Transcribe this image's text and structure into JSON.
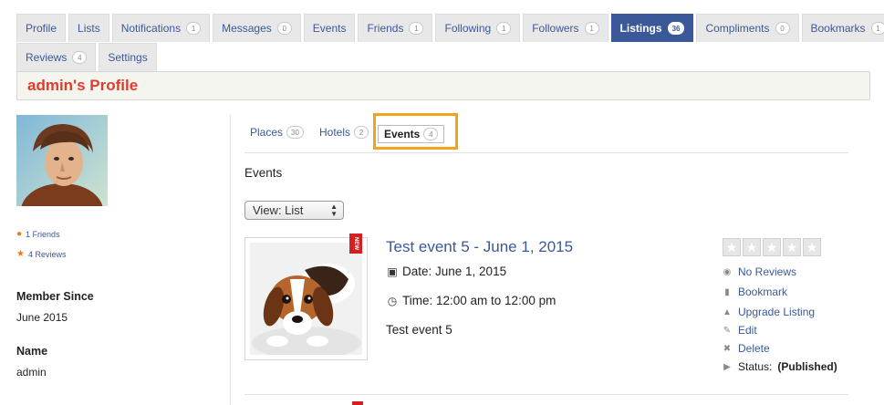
{
  "tabs_row1": [
    {
      "label": "Profile",
      "badge": null,
      "active": false
    },
    {
      "label": "Lists",
      "badge": null,
      "active": false
    },
    {
      "label": "Notifications",
      "badge": "1",
      "active": false
    },
    {
      "label": "Messages",
      "badge": "0",
      "active": false
    },
    {
      "label": "Events",
      "badge": null,
      "active": false
    },
    {
      "label": "Friends",
      "badge": "1",
      "active": false
    },
    {
      "label": "Following",
      "badge": "1",
      "active": false
    },
    {
      "label": "Followers",
      "badge": "1",
      "active": false
    },
    {
      "label": "Listings",
      "badge": "36",
      "active": true
    },
    {
      "label": "Compliments",
      "badge": "0",
      "active": false
    },
    {
      "label": "Bookmarks",
      "badge": "1",
      "active": false
    }
  ],
  "tabs_row2": [
    {
      "label": "Reviews",
      "badge": "4",
      "active": false
    },
    {
      "label": "Settings",
      "badge": null,
      "active": false
    }
  ],
  "profile": {
    "title": "admin's Profile"
  },
  "sidebar": {
    "friends_link": "1 Friends",
    "reviews_link": "4 Reviews",
    "member_since_label": "Member Since",
    "member_since_value": "June 2015",
    "name_label": "Name",
    "name_value": "admin"
  },
  "subtabs": [
    {
      "label": "Places",
      "badge": "30"
    },
    {
      "label": "Hotels",
      "badge": "2"
    },
    {
      "label": "Events",
      "badge": "4"
    }
  ],
  "section": {
    "title": "Events",
    "view_select": "View: List"
  },
  "listing": {
    "ribbon": "NEW",
    "title": "Test event 5 - June 1, 2015",
    "date": "Date: June 1, 2015",
    "time": "Time: 12:00 am to 12:00 pm",
    "description": "Test event 5",
    "rating": 0,
    "actions": {
      "reviews": "No Reviews",
      "bookmark": "Bookmark",
      "upgrade": "Upgrade Listing",
      "edit": "Edit",
      "delete": "Delete",
      "status_label": "Status:",
      "status_value": "(Published)"
    }
  },
  "colors": {
    "accent": "#3b5998",
    "title_red": "#e23b2e",
    "highlight": "#f2a31c"
  }
}
